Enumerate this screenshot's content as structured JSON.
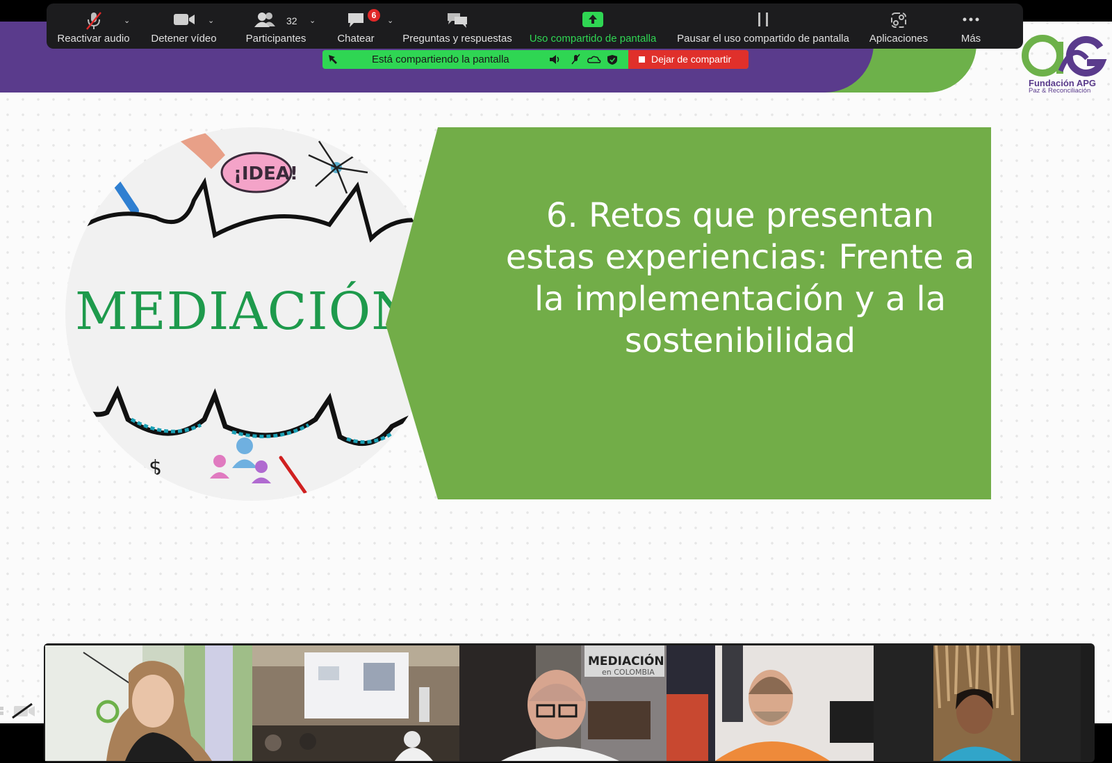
{
  "slide": {
    "title": "6. Retos que presentan estas experiencias: Frente a la implementación y a la sostenibilidad",
    "image_word": "MEDIACIÓN",
    "image_idea_word": "¡IDEA!",
    "logo": {
      "name": "Fundación APG",
      "subtitle": "Paz & Reconciliación"
    },
    "colors": {
      "purple": "#5a3b8c",
      "green": "#72ad48",
      "mediacion_green": "#1e9a4c"
    }
  },
  "toolbar": {
    "unmute": {
      "label": "Reactivar audio",
      "icon": "microphone-muted-icon"
    },
    "stop_video": {
      "label": "Detener vídeo",
      "icon": "video-camera-icon"
    },
    "participants": {
      "label": "Participantes",
      "count": "32",
      "icon": "participants-icon"
    },
    "chat": {
      "label": "Chatear",
      "badge": "6",
      "icon": "chat-icon"
    },
    "qa": {
      "label": "Preguntas y respuestas",
      "icon": "qa-icon"
    },
    "share_screen": {
      "label": "Uso compartido de pantalla",
      "icon": "share-screen-icon",
      "color": "#2fd653"
    },
    "pause_share": {
      "label": "Pausar el uso compartido de pantalla",
      "icon": "pause-icon"
    },
    "apps": {
      "label": "Aplicaciones",
      "icon": "apps-icon"
    },
    "more": {
      "label": "Más",
      "icon": "more-dots-icon"
    }
  },
  "sharebar": {
    "status": "Está compartiendo la pantalla",
    "stop_label": "Dejar de compartir"
  },
  "gallery": {
    "tiles": [
      {
        "id": "participant-1",
        "active": true,
        "poster_text": "MEDIACIÓN",
        "poster_sub": "en COLOMBIA"
      },
      {
        "id": "participant-2",
        "active": false
      },
      {
        "id": "participant-3",
        "active": false
      },
      {
        "id": "participant-4",
        "active": false
      },
      {
        "id": "participant-5",
        "active": false
      }
    ]
  }
}
